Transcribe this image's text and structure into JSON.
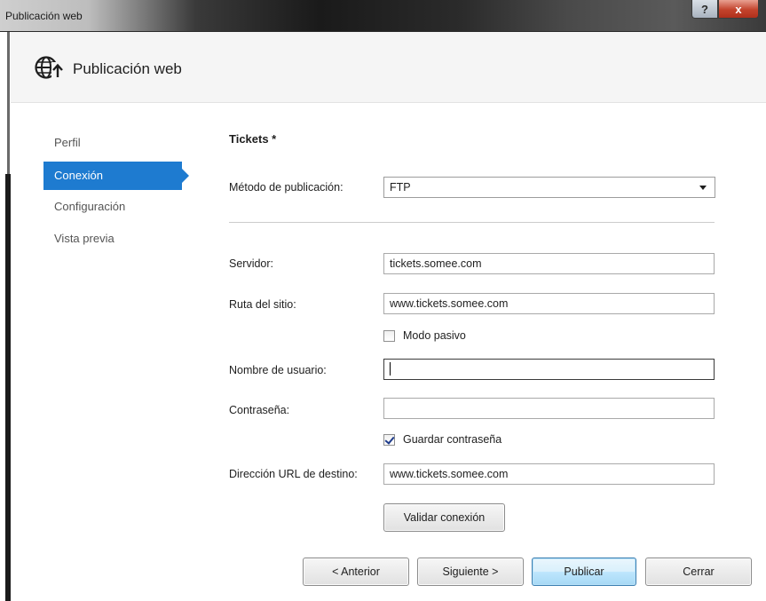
{
  "window": {
    "title": "Publicación web",
    "help_label": "?",
    "close_label": "x"
  },
  "header": {
    "icon": "globe-publish-icon",
    "title": "Publicación web"
  },
  "nav": {
    "items": [
      {
        "label": "Perfil",
        "active": false
      },
      {
        "label": "Conexión",
        "active": true
      },
      {
        "label": "Configuración",
        "active": false
      },
      {
        "label": "Vista previa",
        "active": false
      }
    ]
  },
  "form": {
    "section_title": "Tickets *",
    "method": {
      "label": "Método de publicación:",
      "value": "FTP"
    },
    "server": {
      "label": "Servidor:",
      "value": "tickets.somee.com"
    },
    "site_path": {
      "label": "Ruta del sitio:",
      "value": "www.tickets.somee.com"
    },
    "passive_mode": {
      "label": "Modo pasivo",
      "checked": false
    },
    "username": {
      "label": "Nombre de usuario:",
      "value": ""
    },
    "password": {
      "label": "Contraseña:",
      "value": ""
    },
    "save_password": {
      "label": "Guardar contraseña",
      "checked": true
    },
    "destination_url": {
      "label": "Dirección URL de destino:",
      "value": "www.tickets.somee.com"
    },
    "validate_label": "Validar conexión"
  },
  "footer": {
    "previous_label": "< Anterior",
    "next_label": "Siguiente >",
    "publish_label": "Publicar",
    "close_label": "Cerrar"
  },
  "colors": {
    "accent": "#1e7bd0",
    "close_button": "#c3432c"
  }
}
